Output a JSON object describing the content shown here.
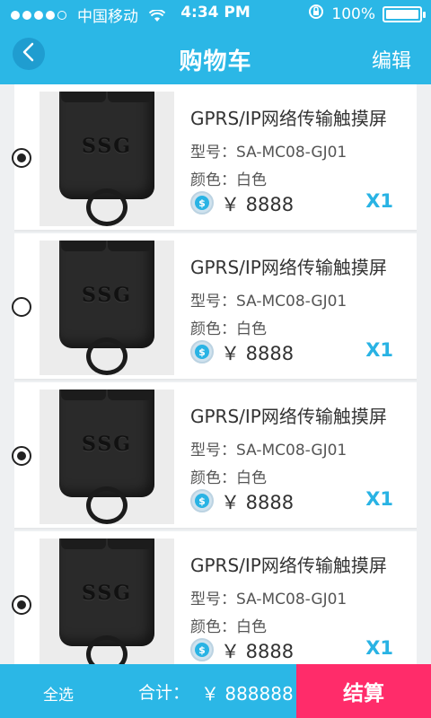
{
  "status": {
    "carrier": "中国移动",
    "time": "4:34 PM",
    "battery": "100%",
    "signal_strength": 4,
    "battery_level": 1.0
  },
  "header": {
    "title": "购物车",
    "edit_label": "编辑"
  },
  "items": [
    {
      "title": "GPRS/IP网络传输触摸屏",
      "model": "型号：SA-MC08-GJ01",
      "color": "颜色：白色",
      "price": "￥ 8888",
      "qty": "X1",
      "selected": true,
      "logo": "SSG"
    },
    {
      "title": "GPRS/IP网络传输触摸屏",
      "model": "型号：SA-MC08-GJ01",
      "color": "颜色：白色",
      "price": "￥ 8888",
      "qty": "X1",
      "selected": false,
      "logo": "SSG"
    },
    {
      "title": "GPRS/IP网络传输触摸屏",
      "model": "型号：SA-MC08-GJ01",
      "color": "颜色：白色",
      "price": "￥ 8888",
      "qty": "X1",
      "selected": true,
      "logo": "SSG"
    },
    {
      "title": "GPRS/IP网络传输触摸屏",
      "model": "型号：SA-MC08-GJ01",
      "color": "颜色：白色",
      "price": "￥ 8888",
      "qty": "X1",
      "selected": true,
      "logo": "SSG"
    }
  ],
  "footer": {
    "select_all_label": "全选",
    "total_label": "合计：",
    "total_value": "￥ 888888",
    "checkout_label": "结算"
  },
  "icons": {
    "back": "chevron-left-icon",
    "wifi": "wifi-icon",
    "lock_rotation": "rotation-lock-icon",
    "coin": "coin-icon"
  },
  "colors": {
    "primary": "#2bb7e6",
    "accent": "#ff2c6a",
    "quantity": "#29b3e4"
  }
}
